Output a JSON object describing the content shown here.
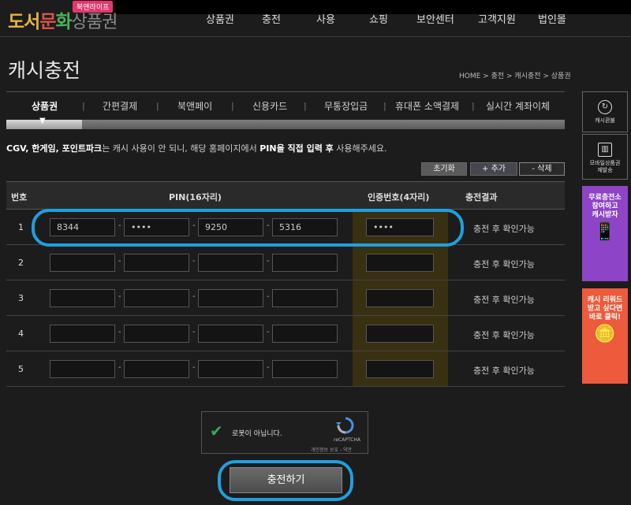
{
  "logo": {
    "part1": "도서",
    "part2": "문",
    "part3": "화",
    "part4": "상품권",
    "badge": "북앤라이프"
  },
  "nav": [
    "상품권",
    "충전",
    "사용",
    "쇼핑",
    "보안센터",
    "고객지원",
    "법인몰"
  ],
  "page_title": "캐시충전",
  "breadcrumb": "HOME > 충전 > 캐시충전 > 상품권",
  "tabs": [
    "상품권",
    "간편결제",
    "북앤페이",
    "신용카드",
    "무통장입금",
    "휴대폰 소액결제",
    "실시간 계좌이체"
  ],
  "notice": {
    "part1": "CGV, 한게임, 포인트파크",
    "part2": "는 캐시 사용이 안 되니, 해당 홈페이지에서 ",
    "part3": "PIN을 직접 입력 후",
    "part4": " 사용해주세요."
  },
  "buttons": {
    "reset": "초기화",
    "add": "+ 추가",
    "delete": "- 삭제",
    "submit": "충전하기"
  },
  "table": {
    "headers": {
      "no": "번호",
      "pin": "PIN(16자리)",
      "auth": "인증번호(4자리)",
      "result": "충전결과"
    },
    "rows": [
      {
        "no": "1",
        "pin": [
          "8344",
          "••••",
          "9250",
          "5316"
        ],
        "auth": "••••",
        "result": "충전 후 확인가능"
      },
      {
        "no": "2",
        "pin": [
          "",
          "",
          "",
          ""
        ],
        "auth": "",
        "result": "충전 후 확인가능"
      },
      {
        "no": "3",
        "pin": [
          "",
          "",
          "",
          ""
        ],
        "auth": "",
        "result": "충전 후 확인가능"
      },
      {
        "no": "4",
        "pin": [
          "",
          "",
          "",
          ""
        ],
        "auth": "",
        "result": "충전 후 확인가능"
      },
      {
        "no": "5",
        "pin": [
          "",
          "",
          "",
          ""
        ],
        "auth": "",
        "result": "충전 후 확인가능"
      }
    ]
  },
  "captcha": {
    "label": "로봇이 아닙니다.",
    "brand": "reCAPTCHA",
    "links": "개인정보 보호 - 약관"
  },
  "side": {
    "refund": "캐시환불",
    "mobile_line1": "모바일상품권",
    "mobile_line2": "재발송",
    "ad1_line1": "무료충전소",
    "ad1_line2": "참여하고",
    "ad1_line3": "캐시받자",
    "ad2_line1": "캐시 리워드",
    "ad2_line2": "받고 싶다면",
    "ad2_line3": "바로 클릭!"
  },
  "colors": {
    "highlight": "#1ea0e0",
    "captcha_check": "#3aa757",
    "badge": "#e4376e"
  }
}
